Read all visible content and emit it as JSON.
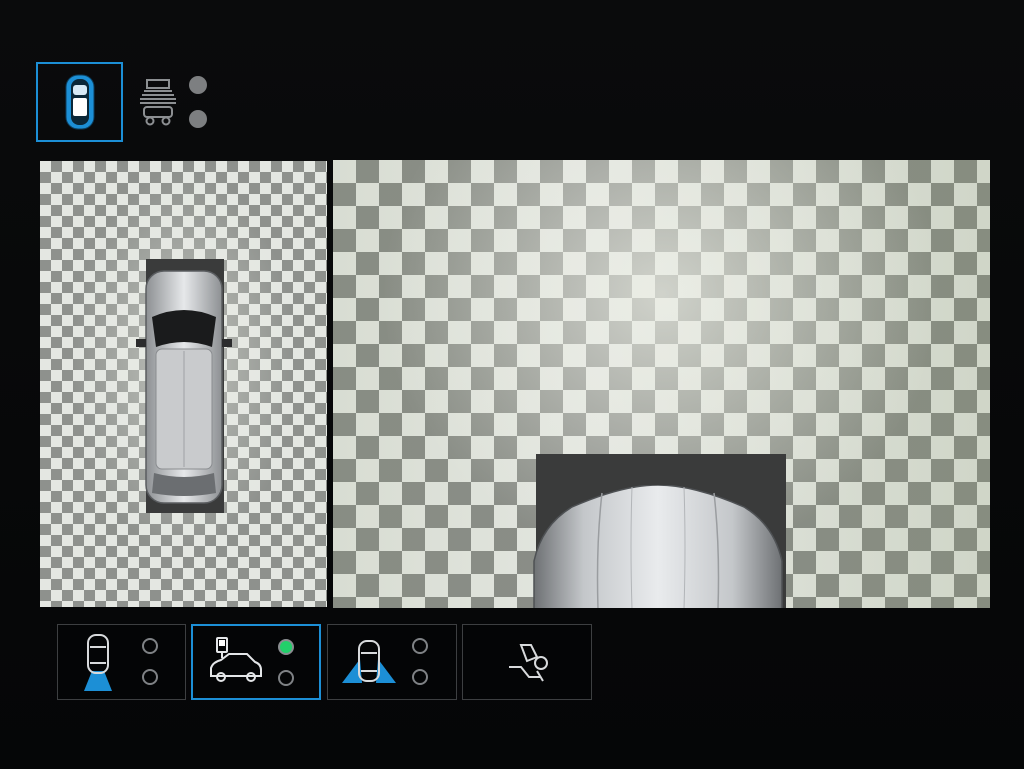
{
  "colors": {
    "accent": "#1c8fd6",
    "active_indicator": "#22d06a",
    "inactive_indicator": "#7d7f81",
    "background": "#050607"
  },
  "top_modes": [
    {
      "icon": "car-top-view-icon",
      "selected": true
    },
    {
      "icon": "trailer-hitch-view-icon",
      "selected": false
    }
  ],
  "top_mode_indicators": [
    {
      "state": "off"
    },
    {
      "state": "off"
    }
  ],
  "camera_views": {
    "left": {
      "type": "overhead-360-view"
    },
    "right": {
      "type": "front-camera-view"
    }
  },
  "bottom_views": [
    {
      "icon": "rear-view-camera-icon",
      "selected": false,
      "indicators": [
        "off",
        "off"
      ]
    },
    {
      "icon": "side-mirror-car-icon",
      "selected": true,
      "indicators": [
        "on",
        "off"
      ]
    },
    {
      "icon": "front-wide-view-icon",
      "selected": false,
      "indicators": [
        "off",
        "off"
      ]
    },
    {
      "icon": "parking-assist-icon",
      "selected": false,
      "indicators": []
    }
  ]
}
